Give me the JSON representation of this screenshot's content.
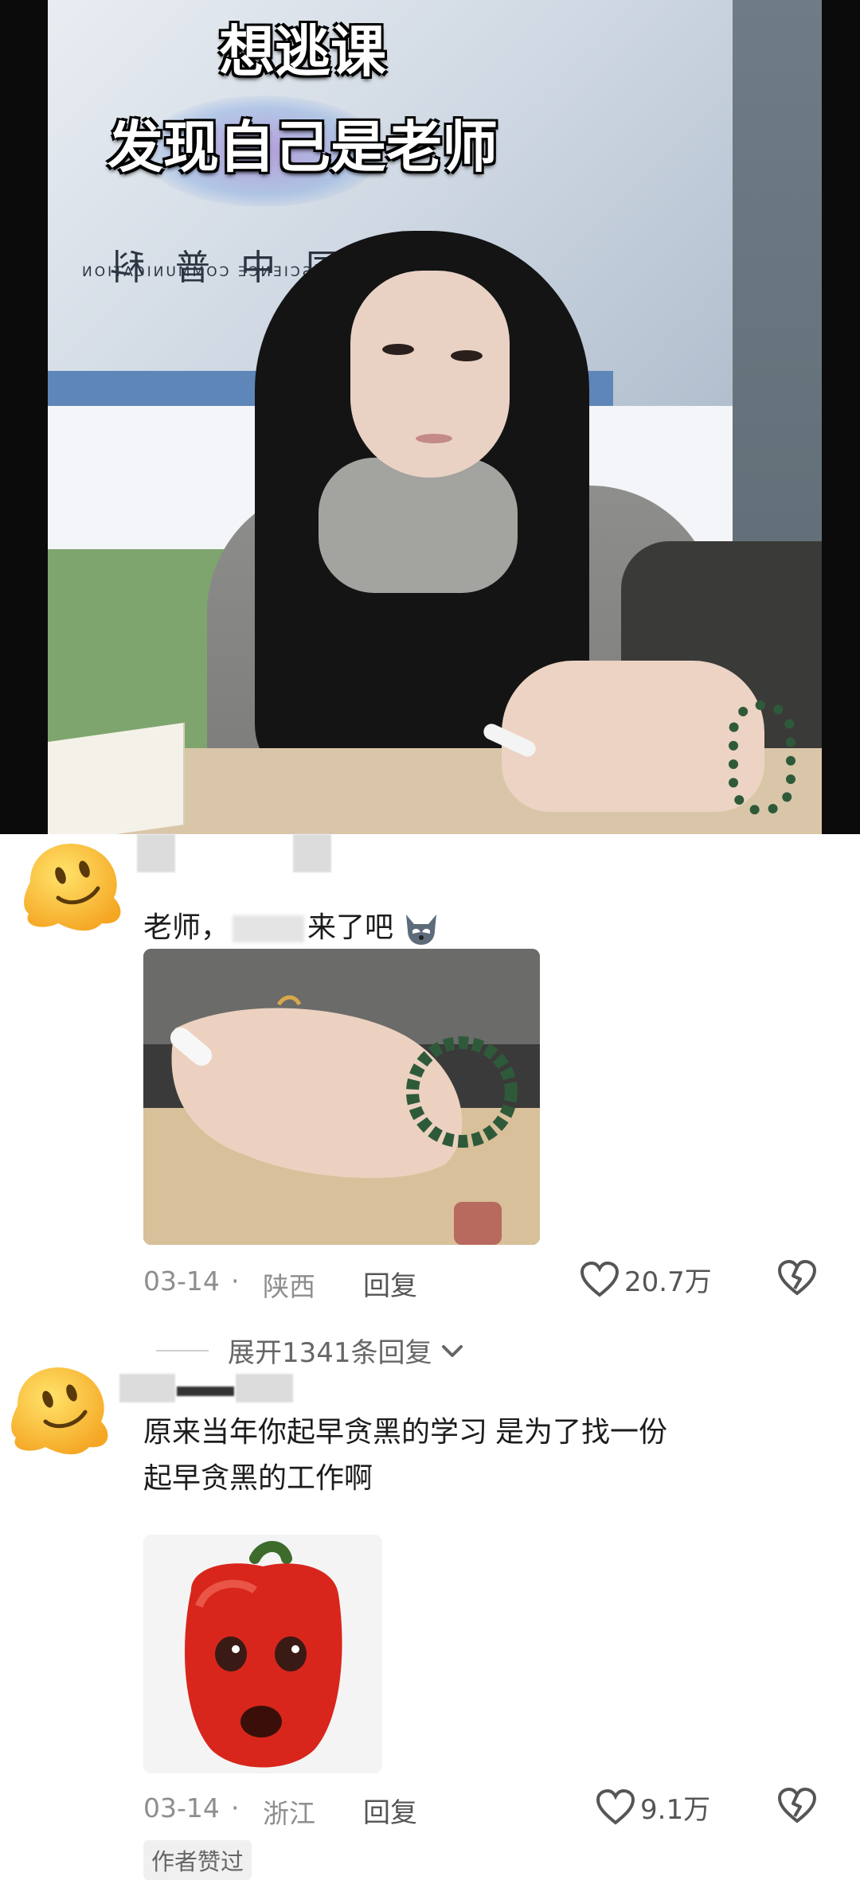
{
  "video": {
    "caption_line1": "想逃课",
    "caption_line2": "发现自己是老师",
    "screen_text_cn": "国中普科",
    "screen_text_en": "A SCIENCE COMMUNICATION"
  },
  "comments": [
    {
      "avatar": "melting-face-emoji",
      "text_part1": "老师，",
      "text_part2": "来了吧",
      "date": "03-14",
      "location": "陕西",
      "reply_label": "回复",
      "likes": "20.7万",
      "expand_label": "展开1341条回复",
      "attached_image": "hand-with-ring-and-jade-bracelet"
    },
    {
      "avatar": "melting-face-emoji",
      "text_line1": "原来当年你起早贪黑的学习 是为了找一份",
      "text_line2": "起早贪黑的工作啊",
      "date": "03-14",
      "location": "浙江",
      "reply_label": "回复",
      "likes": "9.1万",
      "author_badge": "作者赞过",
      "attached_image": "red-pepper-face-meme"
    }
  ],
  "colors": {
    "meta_gray": "#8e8e8e",
    "text_dark": "#1c1c1c"
  }
}
